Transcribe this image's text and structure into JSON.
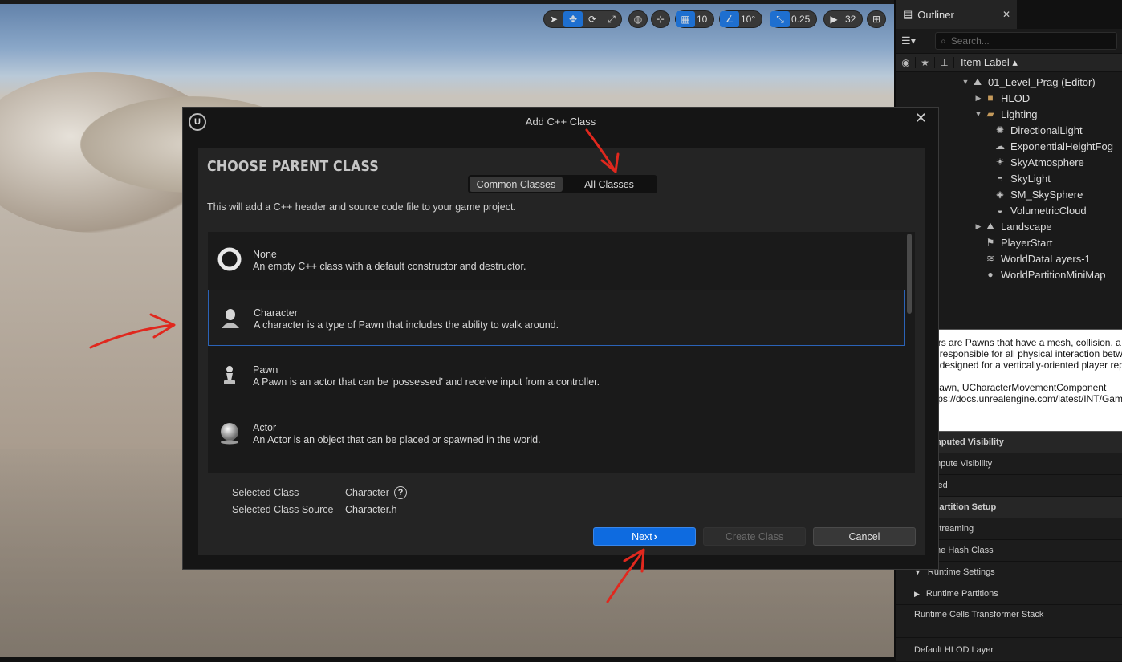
{
  "viewport_toolbar": {
    "grid_snap": "10",
    "rotation_snap": "10°",
    "scale_snap": "0.25",
    "camera_speed": "32"
  },
  "outliner": {
    "tab_label": "Outliner",
    "search_placeholder": "Search...",
    "column_item_label": "Item Label",
    "items": [
      {
        "label": "01_Level_Prag (Editor)",
        "icon": "level-icon"
      },
      {
        "label": "HLOD",
        "icon": "folder-icon"
      },
      {
        "label": "Lighting",
        "icon": "folder-open-icon"
      },
      {
        "label": "DirectionalLight",
        "icon": "directional-light-icon"
      },
      {
        "label": "ExponentialHeightFog",
        "icon": "fog-icon"
      },
      {
        "label": "SkyAtmosphere",
        "icon": "sky-atmosphere-icon"
      },
      {
        "label": "SkyLight",
        "icon": "skylight-icon"
      },
      {
        "label": "SM_SkySphere",
        "icon": "static-mesh-icon"
      },
      {
        "label": "VolumetricCloud",
        "icon": "cloud-icon"
      },
      {
        "label": "Landscape",
        "icon": "landscape-icon"
      },
      {
        "label": "PlayerStart",
        "icon": "player-start-icon"
      },
      {
        "label": "WorldDataLayers-1",
        "icon": "data-layers-icon"
      },
      {
        "label": "WorldPartitionMiniMap",
        "icon": "minimap-icon"
      }
    ]
  },
  "details": {
    "rows": [
      {
        "label": "mputed Visibility",
        "kind": "cat"
      },
      {
        "label": "mpute Visibility",
        "kind": "row"
      },
      {
        "label": "ced",
        "kind": "row"
      },
      {
        "label": "Partition Setup",
        "kind": "cat"
      },
      {
        "label": "Streaming",
        "kind": "row"
      },
      {
        "label": "me Hash Class",
        "kind": "row"
      },
      {
        "label": "Runtime Settings",
        "kind": "row"
      },
      {
        "label": "Runtime Partitions",
        "kind": "sub"
      },
      {
        "label": "Runtime Cells Transformer Stack",
        "kind": "plain"
      },
      {
        "label": "Default HLOD Layer",
        "kind": "plain"
      }
    ]
  },
  "tooltip": {
    "text": "Characters are Pawns that have a mesh, collision, a\nThey are responsible for all physical interaction betw\nThey are designed for a vertically-oriented player rep\n\n@see APawn, UCharacterMovementComponent\n@see https://docs.unrealengine.com/latest/INT/Gam"
  },
  "dialog": {
    "title": "Add C++ Class",
    "heading": "CHOOSE PARENT CLASS",
    "tab_common": "Common Classes",
    "tab_all": "All Classes",
    "description": "This will add a C++ header and source code file to your game project.",
    "classes": [
      {
        "name": "None",
        "description": "An empty C++ class with a default constructor and destructor.",
        "icon": "none-class-icon"
      },
      {
        "name": "Character",
        "description": "A character is a type of Pawn that includes the ability to walk around.",
        "icon": "character-class-icon"
      },
      {
        "name": "Pawn",
        "description": "A Pawn is an actor that can be 'possessed' and receive input from a controller.",
        "icon": "pawn-class-icon"
      },
      {
        "name": "Actor",
        "description": "An Actor is an object that can be placed or spawned in the world.",
        "icon": "actor-class-icon"
      }
    ],
    "selected_class_label": "Selected Class",
    "selected_class_value": "Character",
    "selected_source_label": "Selected Class Source",
    "selected_source_value": "Character.h",
    "next_label": "Next",
    "create_label": "Create Class",
    "cancel_label": "Cancel"
  },
  "colors": {
    "accent": "#0e6be0",
    "selection_border": "#2b63b8",
    "annotation": "#e0281e"
  }
}
